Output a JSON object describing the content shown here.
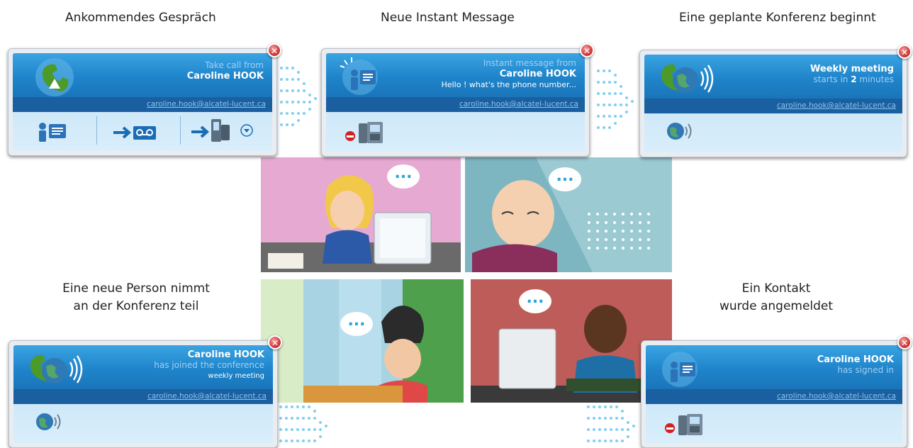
{
  "captions": {
    "incoming_call": "Ankommendes Gespräch",
    "new_im": "Neue Instant Message",
    "conference_start": "Eine geplante Konferenz beginnt",
    "person_joins_line1": "Eine neue Person nimmt",
    "person_joins_line2": "an der Konferenz teil",
    "contact_signed_line1": "Ein Kontakt",
    "contact_signed_line2": "wurde angemeldet"
  },
  "notifications": {
    "call": {
      "line1": "Take call from",
      "name": "Caroline HOOK",
      "email": "caroline.hook@alcatel-lucent.ca",
      "icons": [
        "im-icon",
        "voicemail-icon",
        "transfer-phone-icon",
        "dropdown-icon"
      ]
    },
    "im": {
      "line1": "Instant message from",
      "name": "Caroline HOOK",
      "message": "Hello ! what's the phone number...",
      "email": "caroline.hook@alcatel-lucent.ca",
      "icons": [
        "reject-icon",
        "desk-phone-icon"
      ]
    },
    "meeting": {
      "title": "Weekly meeting",
      "starts_prefix": "starts in",
      "minutes": "2",
      "minutes_suffix": "minutes",
      "email": "caroline.hook@alcatel-lucent.ca"
    },
    "joined": {
      "name": "Caroline HOOK",
      "line2": "has joined the conference",
      "line3": "weekly meeting",
      "email": "caroline.hook@alcatel-lucent.ca"
    },
    "signed": {
      "name": "Caroline HOOK",
      "line2": "has signed in",
      "email": "caroline.hook@alcatel-lucent.ca"
    }
  },
  "bubbles": [
    "...",
    "...",
    "...",
    "..."
  ],
  "colors": {
    "notif_header": "#1f84ca",
    "email_bar": "#1a5f9f",
    "close_button": "#cc2a2a",
    "arrow_dots": "#7fd0f0"
  }
}
